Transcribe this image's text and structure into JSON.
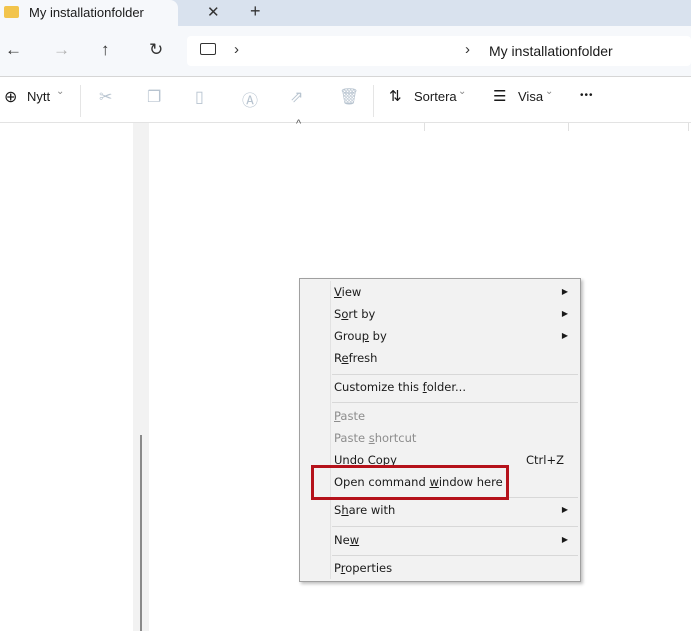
{
  "tab": {
    "title": "My installationfolder",
    "close": "✕",
    "new_tab": "+"
  },
  "nav": {
    "back": "←",
    "forward": "→",
    "up": "↑",
    "refresh": "↻"
  },
  "address": {
    "sep1": "›",
    "sep2": "›",
    "current": "My installationfolder"
  },
  "toolbar": {
    "new_label": "Nytt",
    "sort_label": "Sortera",
    "view_label": "Visa",
    "more": "•••",
    "chevron": "⌄"
  },
  "header": {
    "sort_caret": "^"
  },
  "menu": {
    "items": [
      {
        "pre": "",
        "key": "V",
        "post": "iew",
        "submenu": true
      },
      {
        "pre": "S",
        "key": "o",
        "post": "rt by",
        "submenu": true
      },
      {
        "pre": "Grou",
        "key": "p",
        "post": " by",
        "submenu": true
      },
      {
        "pre": "R",
        "key": "e",
        "post": "fresh"
      },
      {
        "pre": "Customize this ",
        "key": "f",
        "post": "older..."
      },
      {
        "pre": "",
        "key": "P",
        "post": "aste",
        "disabled": true
      },
      {
        "pre": "Paste ",
        "key": "s",
        "post": "hortcut",
        "disabled": true
      },
      {
        "pre": "Undo Copy",
        "key": "",
        "post": "",
        "shortcut": "Ctrl+Z"
      },
      {
        "pre": "Open command ",
        "key": "w",
        "post": "indow here",
        "highlighted": true
      },
      {
        "pre": "S",
        "key": "h",
        "post": "are with",
        "submenu": true
      },
      {
        "pre": "Ne",
        "key": "w",
        "post": "",
        "submenu": true
      },
      {
        "pre": "P",
        "key": "r",
        "post": "operties"
      }
    ]
  },
  "colors": {
    "highlight_box": "#b5121b",
    "accent": "#0067c0"
  }
}
